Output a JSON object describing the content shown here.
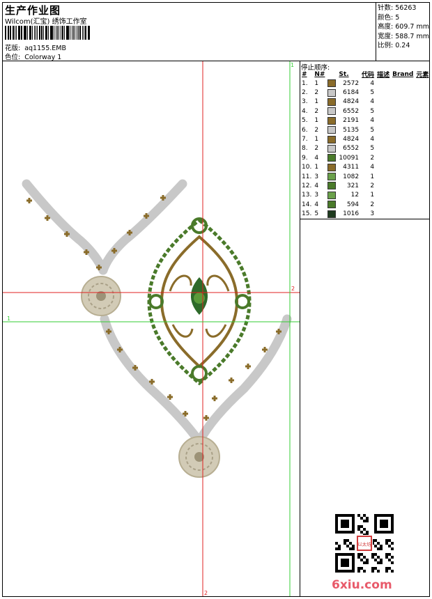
{
  "header": {
    "title": "生产作业图",
    "subtitle": "Wilcom(汇宝) 绣饰工作室",
    "design_label": "花版:",
    "design_value": "aq1155.EMB",
    "color_label": "色位:",
    "color_value": "Colorway 1"
  },
  "stats": [
    {
      "label": "针数:",
      "value": "56263"
    },
    {
      "label": "颜色:",
      "value": "5"
    },
    {
      "label": "高度:",
      "value": "609.7 mm"
    },
    {
      "label": "宽度:",
      "value": "588.7 mm"
    },
    {
      "label": "比例:",
      "value": "0.24"
    }
  ],
  "sequence": {
    "title": "停止顺序:",
    "columns": [
      "#",
      "N#",
      "",
      "St.",
      "代码",
      "描述",
      "Brand",
      "元素"
    ],
    "rows": [
      {
        "idx": "1.",
        "n": "1",
        "color": "#8a6c2a",
        "st": "2572",
        "code": "4"
      },
      {
        "idx": "2.",
        "n": "2",
        "color": "#c8c8c8",
        "st": "6184",
        "code": "5"
      },
      {
        "idx": "3.",
        "n": "1",
        "color": "#8a6c2a",
        "st": "4824",
        "code": "4"
      },
      {
        "idx": "4.",
        "n": "2",
        "color": "#c8c8c8",
        "st": "6552",
        "code": "5"
      },
      {
        "idx": "5.",
        "n": "1",
        "color": "#8a6c2a",
        "st": "2191",
        "code": "4"
      },
      {
        "idx": "6.",
        "n": "2",
        "color": "#c8c8c8",
        "st": "5135",
        "code": "5"
      },
      {
        "idx": "7.",
        "n": "1",
        "color": "#8a6c2a",
        "st": "4824",
        "code": "4"
      },
      {
        "idx": "8.",
        "n": "2",
        "color": "#c8c8c8",
        "st": "6552",
        "code": "5"
      },
      {
        "idx": "9.",
        "n": "4",
        "color": "#4a7a2a",
        "st": "10091",
        "code": "2"
      },
      {
        "idx": "10.",
        "n": "1",
        "color": "#8a6c2a",
        "st": "4311",
        "code": "4"
      },
      {
        "idx": "11.",
        "n": "3",
        "color": "#6aa04a",
        "st": "1082",
        "code": "1"
      },
      {
        "idx": "12.",
        "n": "4",
        "color": "#4a7a2a",
        "st": "321",
        "code": "2"
      },
      {
        "idx": "13.",
        "n": "3",
        "color": "#6aa04a",
        "st": "12",
        "code": "1"
      },
      {
        "idx": "14.",
        "n": "4",
        "color": "#4a7a2a",
        "st": "594",
        "code": "2"
      },
      {
        "idx": "15.",
        "n": "5",
        "color": "#1e3a1e",
        "st": "1016",
        "code": "3"
      }
    ]
  },
  "canvas": {
    "guide_labels": [
      "1",
      "2",
      "1",
      "2"
    ]
  },
  "colors": {
    "gold": "#8a6c2a",
    "silver": "#c8c8c8",
    "green": "#4a7a2a",
    "light_green": "#6aa04a",
    "dark_green": "#1e3a1e",
    "guide_red": "#e02020",
    "guide_green": "#33cc33"
  },
  "qr_badge_text": "以太坊",
  "watermark": "6xiu.com"
}
